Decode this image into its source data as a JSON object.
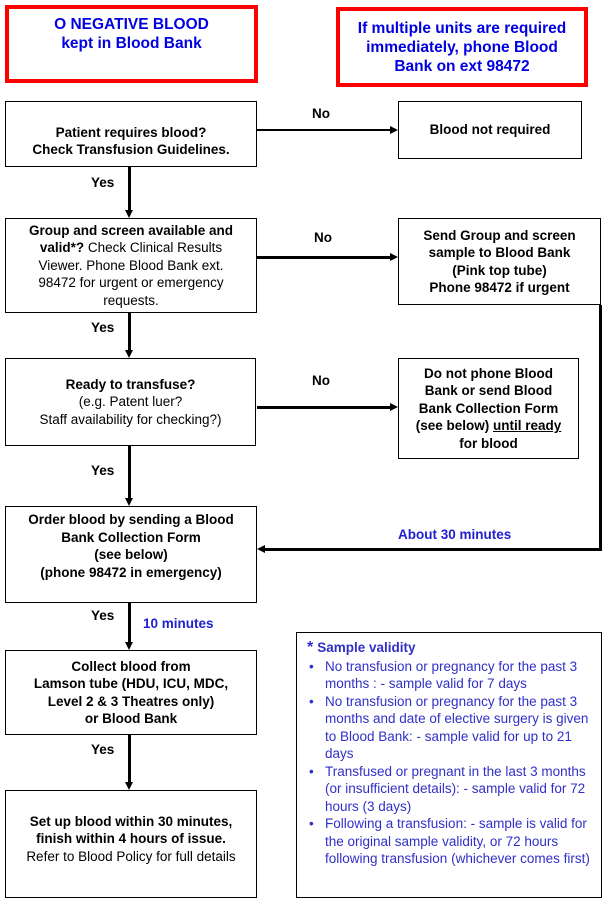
{
  "alerts": {
    "o_negative": {
      "line1": "O NEGATIVE BLOOD",
      "line2": "kept in Blood Bank"
    },
    "multiple_units": {
      "line1": "If multiple units are required",
      "line2": "immediately, phone Blood",
      "line3": "Bank on ext 98472"
    }
  },
  "colors": {
    "alert_border": "#ff0000",
    "alert_text": "#0000e0",
    "note_text": "#3030c8"
  },
  "steps": {
    "patient_requires": {
      "line1": "Patient requires blood?",
      "line2": "Check Transfusion Guidelines."
    },
    "group_screen": {
      "bold": "Group and screen available and valid*?",
      "bold_line1": "Group and screen available and",
      "bold_line2": "valid*?",
      "normal_line2": " Check Clinical Results",
      "normal_line3": "Viewer. Phone Blood Bank ext.",
      "normal_line4": "98472 for urgent or emergency",
      "normal_line5": "requests."
    },
    "ready": {
      "line1": "Ready to transfuse?",
      "line2": "(e.g. Patent luer?",
      "line3": "Staff availability  for checking?)"
    },
    "order": {
      "line1": "Order blood by  sending a Blood",
      "line2": "Bank Collection Form",
      "line3": "(see below)",
      "line4": "(phone 98472  in emergency)"
    },
    "collect": {
      "line1": "Collect blood from",
      "line2": "Lamson tube (HDU, ICU, MDC,",
      "line3": "Level 2 & 3 Theatres only)",
      "line4": "or Blood Bank"
    },
    "setup": {
      "line1": "Set up blood within 30 minutes,",
      "line2": "finish within 4 hours of issue.",
      "line3": "Refer to Blood Policy for full details"
    }
  },
  "outcomes": {
    "not_required": "Blood not required",
    "send_sample": {
      "line1": "Send Group and screen",
      "line2": "sample to Blood Bank",
      "line3": "(Pink top tube)",
      "line4": "Phone 98472  if urgent"
    },
    "do_not_phone": {
      "line1": "Do not phone Blood",
      "line2": "Bank or send Blood",
      "line3": "Bank Collection Form",
      "line4_pre": "(see below) ",
      "line4_u": "until ready",
      "line5": "for blood"
    }
  },
  "labels": {
    "yes": "Yes",
    "no": "No",
    "about_30": "About 30 minutes",
    "ten_minutes": "10 minutes"
  },
  "sample_validity": {
    "star": "*",
    "title": "Sample validity",
    "bullet": "•",
    "items": [
      "No transfusion or pregnancy for the past 3 months : - sample valid  for 7 days",
      "No transfusion or pregnancy for the past 3 months and date of elective  surgery is given to Blood Bank: - sample valid for up to 21 days",
      "Transfused or pregnant in the last 3 months (or insufficient details): - sample valid for 72 hours (3 days)",
      "Following a transfusion: - sample is valid for the original  sample validity,  or 72 hours following transfusion (whichever comes first)"
    ]
  }
}
